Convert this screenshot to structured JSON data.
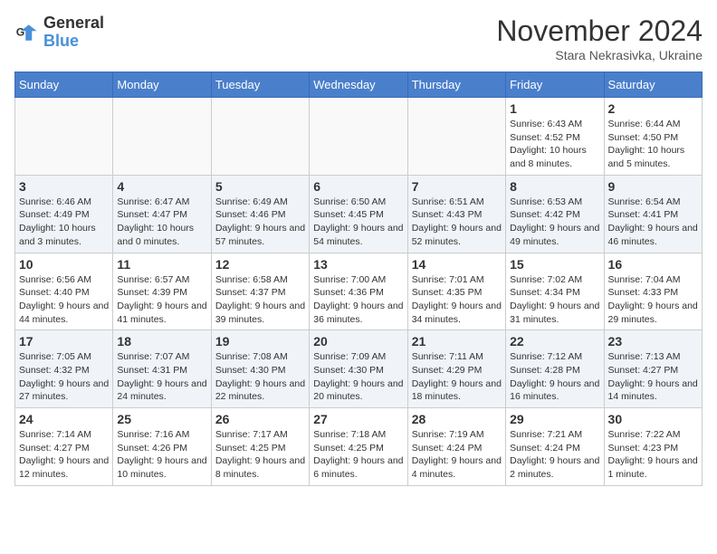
{
  "header": {
    "logo_line1": "General",
    "logo_line2": "Blue",
    "month_title": "November 2024",
    "subtitle": "Stara Nekrasivka, Ukraine"
  },
  "days_of_week": [
    "Sunday",
    "Monday",
    "Tuesday",
    "Wednesday",
    "Thursday",
    "Friday",
    "Saturday"
  ],
  "weeks": [
    [
      {
        "day": "",
        "info": ""
      },
      {
        "day": "",
        "info": ""
      },
      {
        "day": "",
        "info": ""
      },
      {
        "day": "",
        "info": ""
      },
      {
        "day": "",
        "info": ""
      },
      {
        "day": "1",
        "info": "Sunrise: 6:43 AM\nSunset: 4:52 PM\nDaylight: 10 hours and 8 minutes."
      },
      {
        "day": "2",
        "info": "Sunrise: 6:44 AM\nSunset: 4:50 PM\nDaylight: 10 hours and 5 minutes."
      }
    ],
    [
      {
        "day": "3",
        "info": "Sunrise: 6:46 AM\nSunset: 4:49 PM\nDaylight: 10 hours and 3 minutes."
      },
      {
        "day": "4",
        "info": "Sunrise: 6:47 AM\nSunset: 4:47 PM\nDaylight: 10 hours and 0 minutes."
      },
      {
        "day": "5",
        "info": "Sunrise: 6:49 AM\nSunset: 4:46 PM\nDaylight: 9 hours and 57 minutes."
      },
      {
        "day": "6",
        "info": "Sunrise: 6:50 AM\nSunset: 4:45 PM\nDaylight: 9 hours and 54 minutes."
      },
      {
        "day": "7",
        "info": "Sunrise: 6:51 AM\nSunset: 4:43 PM\nDaylight: 9 hours and 52 minutes."
      },
      {
        "day": "8",
        "info": "Sunrise: 6:53 AM\nSunset: 4:42 PM\nDaylight: 9 hours and 49 minutes."
      },
      {
        "day": "9",
        "info": "Sunrise: 6:54 AM\nSunset: 4:41 PM\nDaylight: 9 hours and 46 minutes."
      }
    ],
    [
      {
        "day": "10",
        "info": "Sunrise: 6:56 AM\nSunset: 4:40 PM\nDaylight: 9 hours and 44 minutes."
      },
      {
        "day": "11",
        "info": "Sunrise: 6:57 AM\nSunset: 4:39 PM\nDaylight: 9 hours and 41 minutes."
      },
      {
        "day": "12",
        "info": "Sunrise: 6:58 AM\nSunset: 4:37 PM\nDaylight: 9 hours and 39 minutes."
      },
      {
        "day": "13",
        "info": "Sunrise: 7:00 AM\nSunset: 4:36 PM\nDaylight: 9 hours and 36 minutes."
      },
      {
        "day": "14",
        "info": "Sunrise: 7:01 AM\nSunset: 4:35 PM\nDaylight: 9 hours and 34 minutes."
      },
      {
        "day": "15",
        "info": "Sunrise: 7:02 AM\nSunset: 4:34 PM\nDaylight: 9 hours and 31 minutes."
      },
      {
        "day": "16",
        "info": "Sunrise: 7:04 AM\nSunset: 4:33 PM\nDaylight: 9 hours and 29 minutes."
      }
    ],
    [
      {
        "day": "17",
        "info": "Sunrise: 7:05 AM\nSunset: 4:32 PM\nDaylight: 9 hours and 27 minutes."
      },
      {
        "day": "18",
        "info": "Sunrise: 7:07 AM\nSunset: 4:31 PM\nDaylight: 9 hours and 24 minutes."
      },
      {
        "day": "19",
        "info": "Sunrise: 7:08 AM\nSunset: 4:30 PM\nDaylight: 9 hours and 22 minutes."
      },
      {
        "day": "20",
        "info": "Sunrise: 7:09 AM\nSunset: 4:30 PM\nDaylight: 9 hours and 20 minutes."
      },
      {
        "day": "21",
        "info": "Sunrise: 7:11 AM\nSunset: 4:29 PM\nDaylight: 9 hours and 18 minutes."
      },
      {
        "day": "22",
        "info": "Sunrise: 7:12 AM\nSunset: 4:28 PM\nDaylight: 9 hours and 16 minutes."
      },
      {
        "day": "23",
        "info": "Sunrise: 7:13 AM\nSunset: 4:27 PM\nDaylight: 9 hours and 14 minutes."
      }
    ],
    [
      {
        "day": "24",
        "info": "Sunrise: 7:14 AM\nSunset: 4:27 PM\nDaylight: 9 hours and 12 minutes."
      },
      {
        "day": "25",
        "info": "Sunrise: 7:16 AM\nSunset: 4:26 PM\nDaylight: 9 hours and 10 minutes."
      },
      {
        "day": "26",
        "info": "Sunrise: 7:17 AM\nSunset: 4:25 PM\nDaylight: 9 hours and 8 minutes."
      },
      {
        "day": "27",
        "info": "Sunrise: 7:18 AM\nSunset: 4:25 PM\nDaylight: 9 hours and 6 minutes."
      },
      {
        "day": "28",
        "info": "Sunrise: 7:19 AM\nSunset: 4:24 PM\nDaylight: 9 hours and 4 minutes."
      },
      {
        "day": "29",
        "info": "Sunrise: 7:21 AM\nSunset: 4:24 PM\nDaylight: 9 hours and 2 minutes."
      },
      {
        "day": "30",
        "info": "Sunrise: 7:22 AM\nSunset: 4:23 PM\nDaylight: 9 hours and 1 minute."
      }
    ]
  ]
}
